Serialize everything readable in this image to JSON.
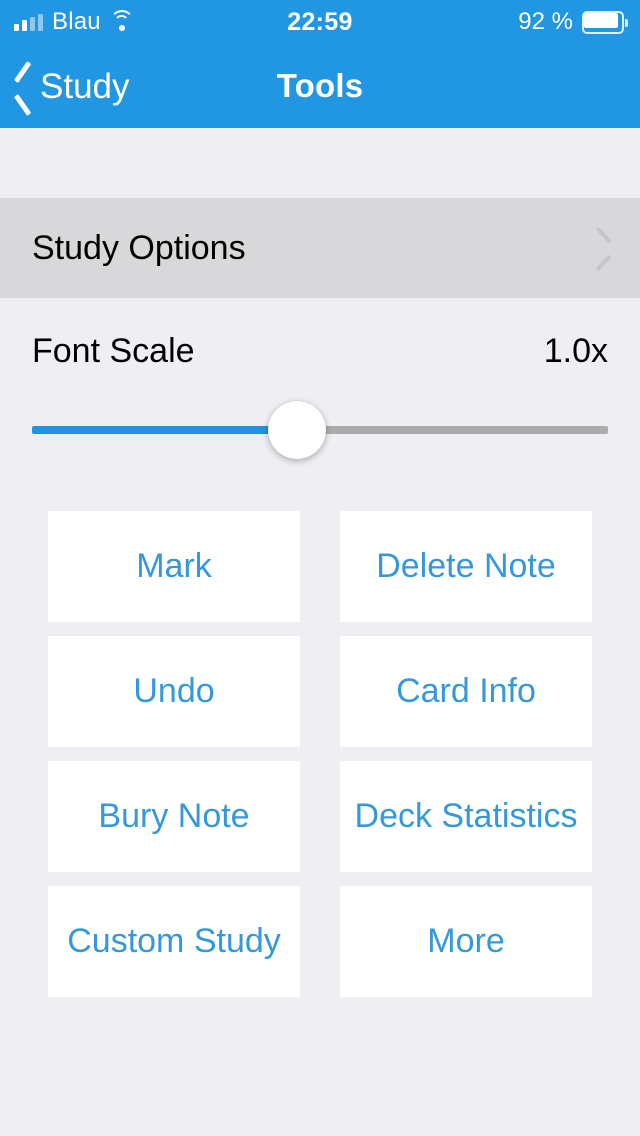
{
  "status_bar": {
    "carrier": "Blau",
    "time": "22:59",
    "battery_percent": "92 %",
    "signal_icon": "signal-bars-icon",
    "wifi_icon": "wifi-icon",
    "battery_icon": "battery-icon"
  },
  "nav": {
    "back_label": "Study",
    "back_icon": "chevron-left-icon",
    "title": "Tools"
  },
  "options_row": {
    "label": "Study Options",
    "disclosure_icon": "chevron-right-icon"
  },
  "font_scale": {
    "label": "Font Scale",
    "value": "1.0x",
    "slider_percent": 46
  },
  "tools": [
    {
      "label": "Mark"
    },
    {
      "label": "Delete Note"
    },
    {
      "label": "Undo"
    },
    {
      "label": "Card Info"
    },
    {
      "label": "Bury Note"
    },
    {
      "label": "Deck Statistics"
    },
    {
      "label": "Custom Study"
    },
    {
      "label": "More"
    }
  ],
  "colors": {
    "accent_blue": "#2196E3",
    "button_text": "#3498DB",
    "slider_fill": "#1F93E3",
    "slider_track": "#ACACAC",
    "background": "#EFEEF3",
    "row_highlight": "#D8D8DA"
  }
}
